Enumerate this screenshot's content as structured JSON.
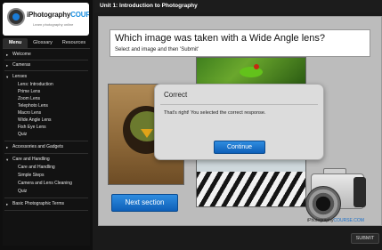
{
  "logo": {
    "brand_prefix": "iPhotography",
    "brand_accent": "COURSE.COM",
    "tagline": "Learn photography online"
  },
  "sidebar": {
    "tabs": [
      {
        "label": "Menu",
        "active": true
      },
      {
        "label": "Glossary",
        "active": false
      },
      {
        "label": "Resources",
        "active": false
      }
    ],
    "menu": {
      "welcome": "Welcome",
      "cameras": "Cameras",
      "lenses": "Lenses",
      "lenses_items": [
        "Lens: Introduction",
        "Prime Lens",
        "Zoom Lens",
        "Telephoto Lens",
        "Macro Lens",
        "Wide Angle Lens",
        "Fish Eye Lens",
        "Quiz"
      ],
      "accessories": "Accessories and Gadgets",
      "care": "Care and Handling",
      "care_items": [
        "Care and Handling",
        "Simple Steps",
        "Camera and Lens Cleaning",
        "Quiz"
      ],
      "terms": "Basic Photographic Terms"
    }
  },
  "header": {
    "title": "Unit 1: Introduction to Photography"
  },
  "question": {
    "title": "Which image was taken with a Wide Angle lens?",
    "instruction": "Select and image and then 'Submit'"
  },
  "dialog": {
    "title": "Correct",
    "message": "That's right!  You selected the correct response.",
    "button": "Continue"
  },
  "next_button": "Next section",
  "watermark": {
    "prefix": "iPhotography",
    "accent": "COURSE.COM"
  },
  "submit_button": "SUBMIT",
  "colors": {
    "accent_blue": "#1a7bd6",
    "sidebar_bg": "#0f0f0f",
    "content_bg": "#bcbcbc"
  }
}
